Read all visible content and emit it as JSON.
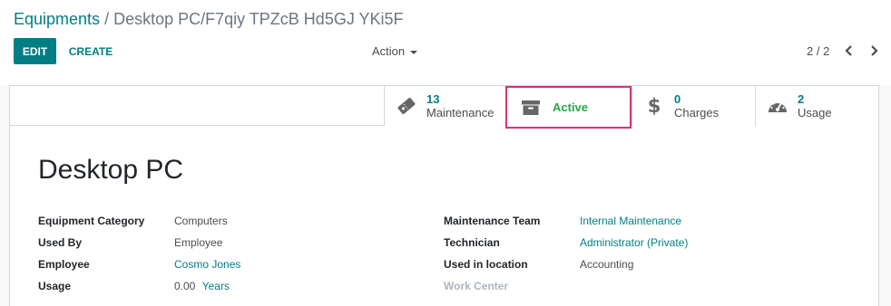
{
  "breadcrumb": {
    "parent": "Equipments",
    "separator": "/",
    "current": "Desktop PC/F7qiy TPZcB Hd5GJ YKi5F"
  },
  "toolbar": {
    "edit_label": "EDIT",
    "create_label": "CREATE",
    "action_label": "Action",
    "pager": "2 / 2"
  },
  "stat_buttons": {
    "maintenance": {
      "count": "13",
      "label": "Maintenance",
      "icon": "ticket-icon"
    },
    "active": {
      "label": "Active",
      "icon": "archive-icon"
    },
    "charges": {
      "count": "0",
      "label": "Charges",
      "icon": "dollar-icon"
    },
    "usage": {
      "count": "2",
      "label": "Usage",
      "icon": "dashboard-icon"
    }
  },
  "form": {
    "title": "Desktop PC",
    "left": {
      "equipment_category_label": "Equipment Category",
      "equipment_category_value": "Computers",
      "used_by_label": "Used By",
      "used_by_value": "Employee",
      "employee_label": "Employee",
      "employee_value": "Cosmo Jones",
      "usage_label": "Usage",
      "usage_value": "0.00",
      "usage_unit": "Years"
    },
    "right": {
      "maintenance_team_label": "Maintenance Team",
      "maintenance_team_value": "Internal Maintenance",
      "technician_label": "Technician",
      "technician_value": "Administrator (Private)",
      "used_in_location_label": "Used in location",
      "used_in_location_value": "Accounting",
      "work_center_label": "Work Center"
    }
  },
  "colors": {
    "primary": "#017e84",
    "active_green": "#28a745",
    "highlight": "#d63377"
  }
}
